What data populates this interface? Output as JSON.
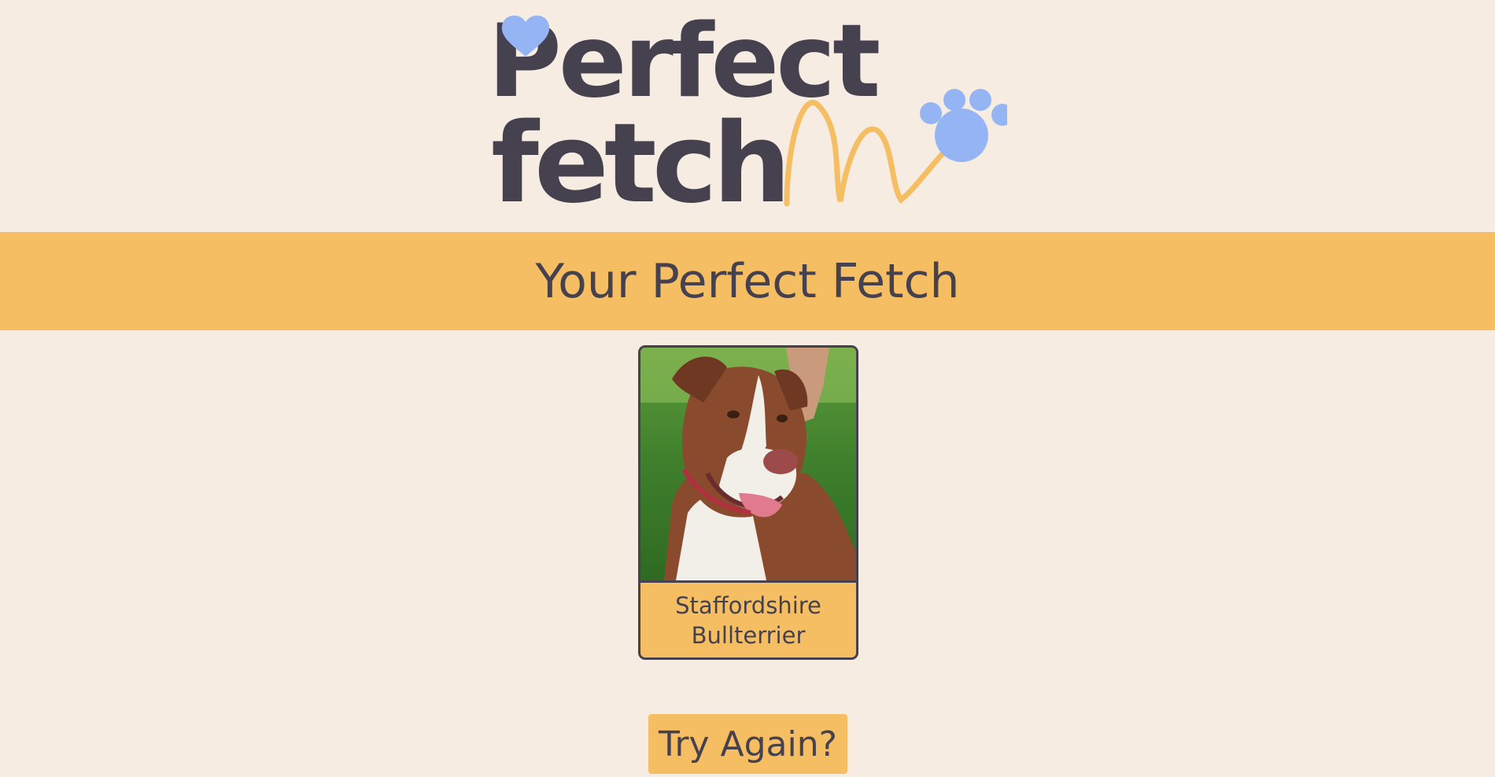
{
  "logo": {
    "line1": "Perfect",
    "line2": "fetch"
  },
  "banner": {
    "title": "Your Perfect Fetch"
  },
  "result": {
    "breed": "Staffordshire Bullterrier",
    "photo_subject": "brown and white dog"
  },
  "actions": {
    "try_again_label": "Try Again?"
  },
  "colors": {
    "background": "#f7ece2",
    "accent": "#f5be62",
    "text": "#46414f",
    "logo_blue": "#94b4f4"
  },
  "icons": [
    "heart-icon",
    "paw-print-icon"
  ]
}
